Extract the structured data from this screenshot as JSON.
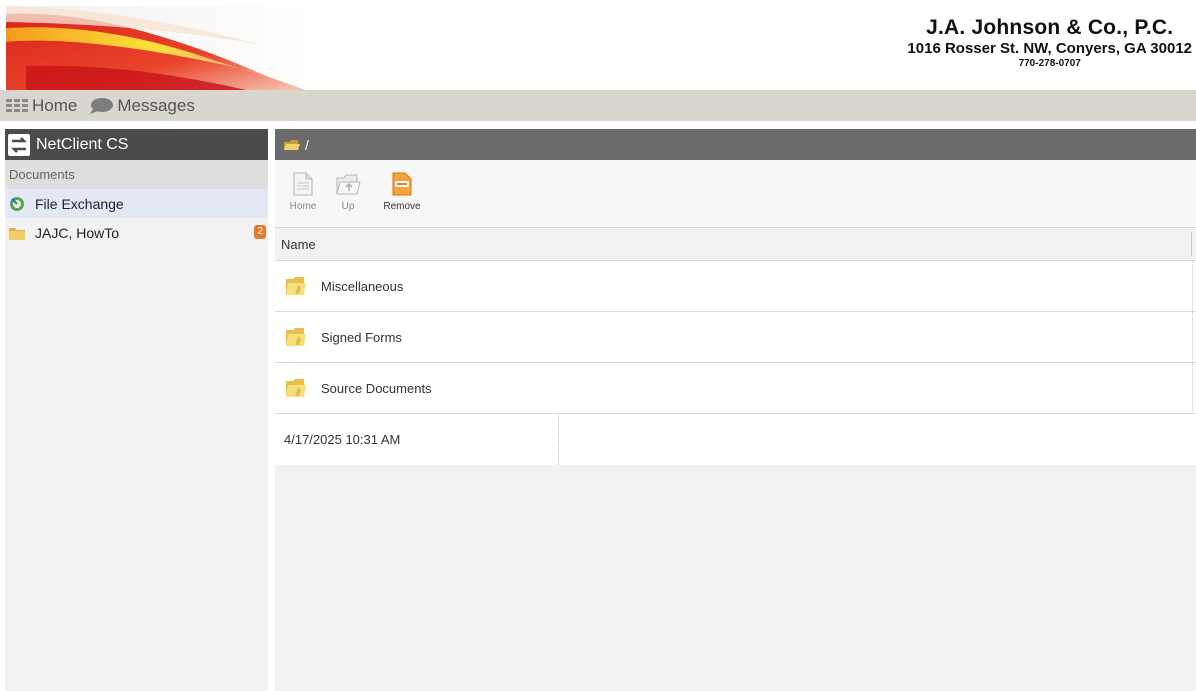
{
  "firm": {
    "name": "J.A. Johnson & Co., P.C.",
    "address": "1016 Rosser St. NW, Conyers, GA 30012",
    "phone": "770-278-0707"
  },
  "topnav": {
    "home": {
      "label": "Home",
      "icon": "grid-icon"
    },
    "messages": {
      "label": "Messages",
      "icon": "chat-bubble-icon"
    }
  },
  "sidebar": {
    "title": "NetClient CS",
    "title_icon": "netclient-logo-icon",
    "section": "Documents",
    "items": [
      {
        "label": "File Exchange",
        "icon": "file-exchange-icon",
        "active": true
      },
      {
        "label": "JAJC, HowTo",
        "icon": "folder-icon",
        "badge": "2"
      }
    ]
  },
  "main": {
    "path": "/",
    "toolbar": {
      "home": "Home",
      "up": "Up",
      "remove": "Remove"
    },
    "columns": {
      "name": "Name"
    },
    "folders": [
      {
        "name": "Miscellaneous"
      },
      {
        "name": "Signed Forms"
      },
      {
        "name": "Source Documents"
      }
    ],
    "footer_timestamp": "4/17/2025 10:31 AM"
  },
  "colors": {
    "nav_bg": "#d9d6d0",
    "sidebar_head": "#4b4b4b",
    "path_bar": "#6b6b6b",
    "badge": "#e8792d",
    "active_item": "#e4e8f5"
  }
}
